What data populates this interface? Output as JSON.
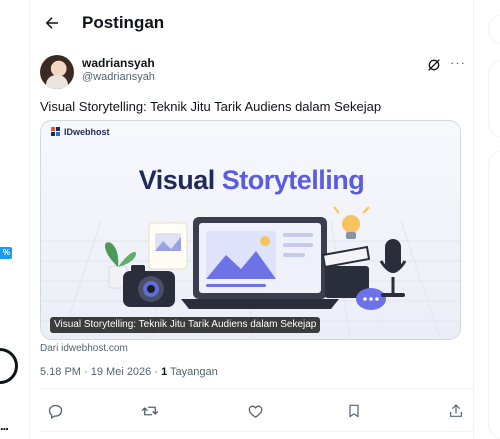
{
  "left_column": {
    "badge": "%",
    "dots": "..."
  },
  "header": {
    "title": "Postingan",
    "back_icon": "arrow-left-icon"
  },
  "post": {
    "author_name": "wadriansyah",
    "author_handle": "@wadriansyah",
    "text": "Visual Storytelling: Teknik Jitu Tarik Audiens dalam Sekejap",
    "card": {
      "brand": "IDwebhost",
      "headline_part1": "Visual",
      "headline_part2": "Storytelling",
      "caption": "Visual Storytelling: Teknik Jitu Tarik Audiens dalam Sekejap"
    },
    "source": "Dari idwebhost.com",
    "timestamp": "5.18 PM · 19 Mei 2026 · ",
    "views_count": "1",
    "views_label": "Tayangan",
    "more_label": "···"
  },
  "actions": [
    "reply-icon",
    "repost-icon",
    "like-icon",
    "bookmark-icon",
    "share-icon"
  ],
  "colors": {
    "accent": "#1d9bf0",
    "text": "#0f1419",
    "muted": "#536471",
    "headline_dark": "#1e2a5a",
    "headline_accent": "#5b5ce0"
  }
}
